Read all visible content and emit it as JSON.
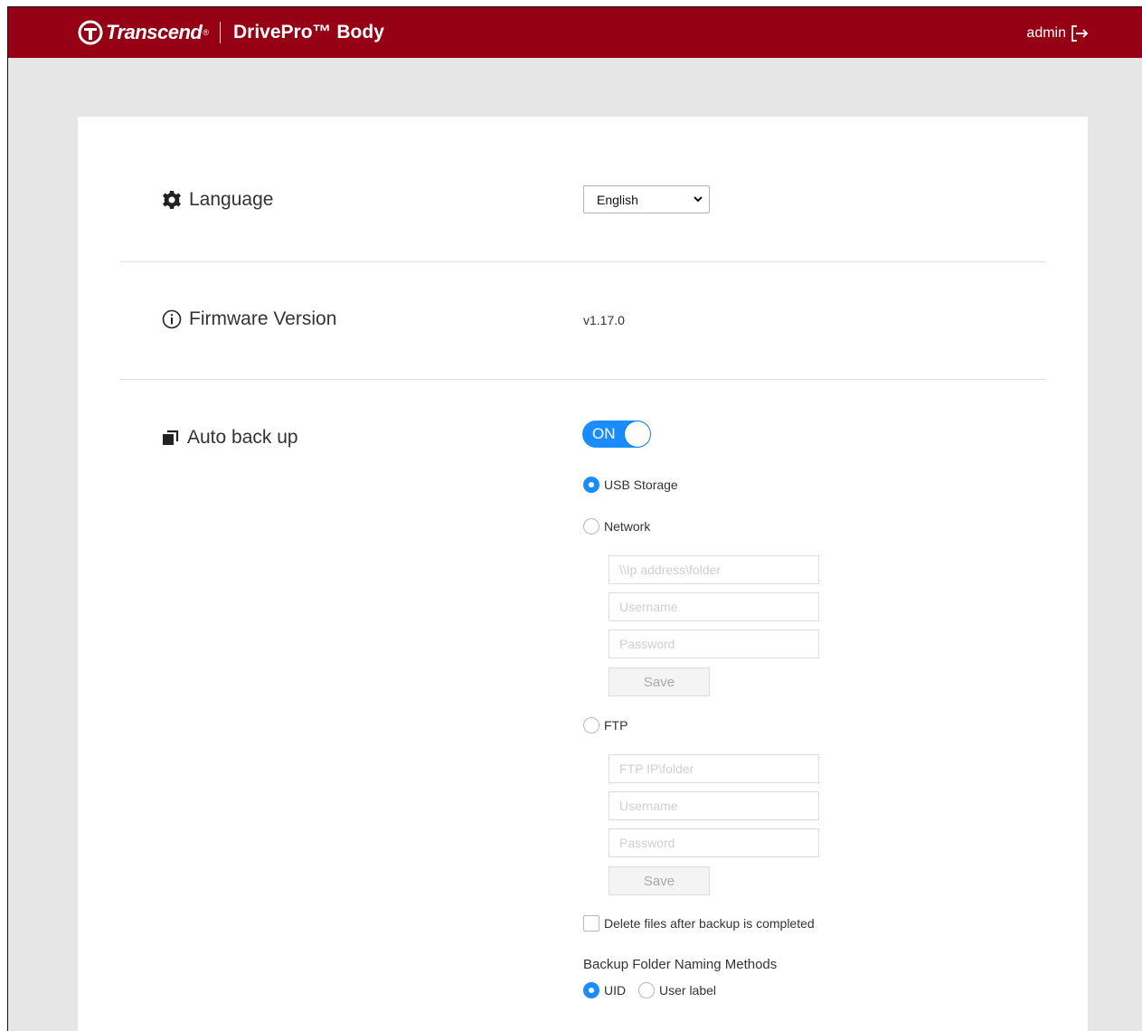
{
  "header": {
    "brand": "Transcend",
    "brand_mark": "®",
    "product": "DrivePro™ Body",
    "user": "admin",
    "logout_icon": "logout-icon"
  },
  "settings": {
    "language": {
      "title": "Language",
      "icon": "gear-icon",
      "selected": "English"
    },
    "firmware": {
      "title": "Firmware Version",
      "icon": "info-icon",
      "value": "v1.17.0"
    },
    "auto_backup": {
      "title": "Auto back up",
      "icon": "copy-icon",
      "toggle_label": "ON",
      "toggle_on": true,
      "destination": {
        "usb": {
          "label": "USB Storage",
          "checked": true
        },
        "network": {
          "label": "Network",
          "checked": false,
          "path_placeholder": "\\\\Ip address\\folder",
          "username_placeholder": "Username",
          "password_placeholder": "Password",
          "save_label": "Save"
        },
        "ftp": {
          "label": "FTP",
          "checked": false,
          "path_placeholder": "FTP IP\\folder",
          "username_placeholder": "Username",
          "password_placeholder": "Password",
          "save_label": "Save"
        }
      },
      "delete_after": {
        "label": "Delete files after backup is completed",
        "checked": false
      },
      "naming": {
        "title": "Backup Folder Naming Methods",
        "uid": {
          "label": "UID",
          "checked": true
        },
        "user_label": {
          "label": "User label",
          "checked": false
        }
      }
    }
  },
  "colors": {
    "brand": "#950014",
    "accent": "#1a8cff",
    "background": "#e6e6e6"
  }
}
